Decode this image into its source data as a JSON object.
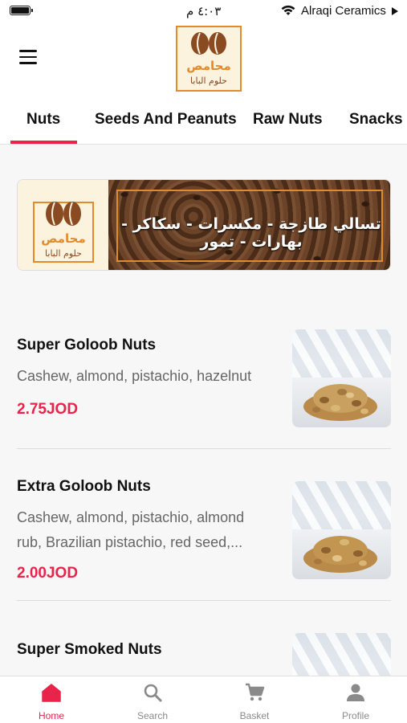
{
  "status_bar": {
    "time": "٤:٠٣ م",
    "carrier": "Alraqi Ceramics"
  },
  "header": {
    "menu_icon": "hamburger-menu-icon",
    "logo_text": {
      "line1": "محامص",
      "line2": "حلوم البابا"
    }
  },
  "tabs": [
    {
      "label": "Nuts",
      "active": true
    },
    {
      "label": "Seeds And Peanuts",
      "active": false
    },
    {
      "label": "Raw Nuts",
      "active": false
    },
    {
      "label": "Snacks",
      "active": false
    }
  ],
  "banner": {
    "text": "تسالي طازجة - مكسرات - سكاكر - بهارات - تمور"
  },
  "products": [
    {
      "name": "Super Goloob Nuts",
      "description": "Cashew, almond, pistachio, hazelnut",
      "price": "2.75JOD"
    },
    {
      "name": "Extra Goloob Nuts",
      "description_line1": "Cashew, almond, pistachio, almond",
      "description_line2": "rub, Brazilian pistachio, red seed,...",
      "price": "2.00JOD"
    },
    {
      "name": "Super Smoked Nuts"
    }
  ],
  "bottom_nav": [
    {
      "label": "Home",
      "icon": "home-icon",
      "active": true
    },
    {
      "label": "Search",
      "icon": "search-icon",
      "active": false
    },
    {
      "label": "Basket",
      "icon": "cart-icon",
      "active": false
    },
    {
      "label": "Profile",
      "icon": "profile-icon",
      "active": false
    }
  ],
  "colors": {
    "accent": "#e8244a",
    "logo_brown": "#8a4a22",
    "logo_orange": "#e38a2d",
    "banner_cream": "#fbf3dd"
  }
}
